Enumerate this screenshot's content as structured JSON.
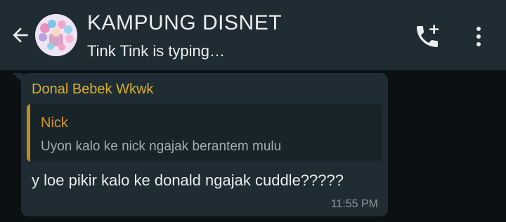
{
  "header": {
    "title": "KAMPUNG DISNET",
    "status": "Tink Tink is typing…",
    "icons": {
      "back": "arrow-back-icon",
      "avatar": "group-avatar",
      "call": "add-call-icon",
      "menu": "more-vert-icon"
    }
  },
  "message": {
    "sender": "Donal Bebek Wkwk",
    "quoted": {
      "author": "Nick",
      "text": "Uyon kalo ke nick ngajak berantem mulu"
    },
    "text": "y loe pikir kalo ke donald ngajak cuddle?????",
    "time": "11:55 PM"
  },
  "colors": {
    "header_bg": "#1f2c33",
    "chat_bg": "#0b1013",
    "bubble_bg": "#1f2c33",
    "sender": "#d9b02c",
    "quote_author": "#d8942b",
    "quote_bar": "#c68a22"
  }
}
